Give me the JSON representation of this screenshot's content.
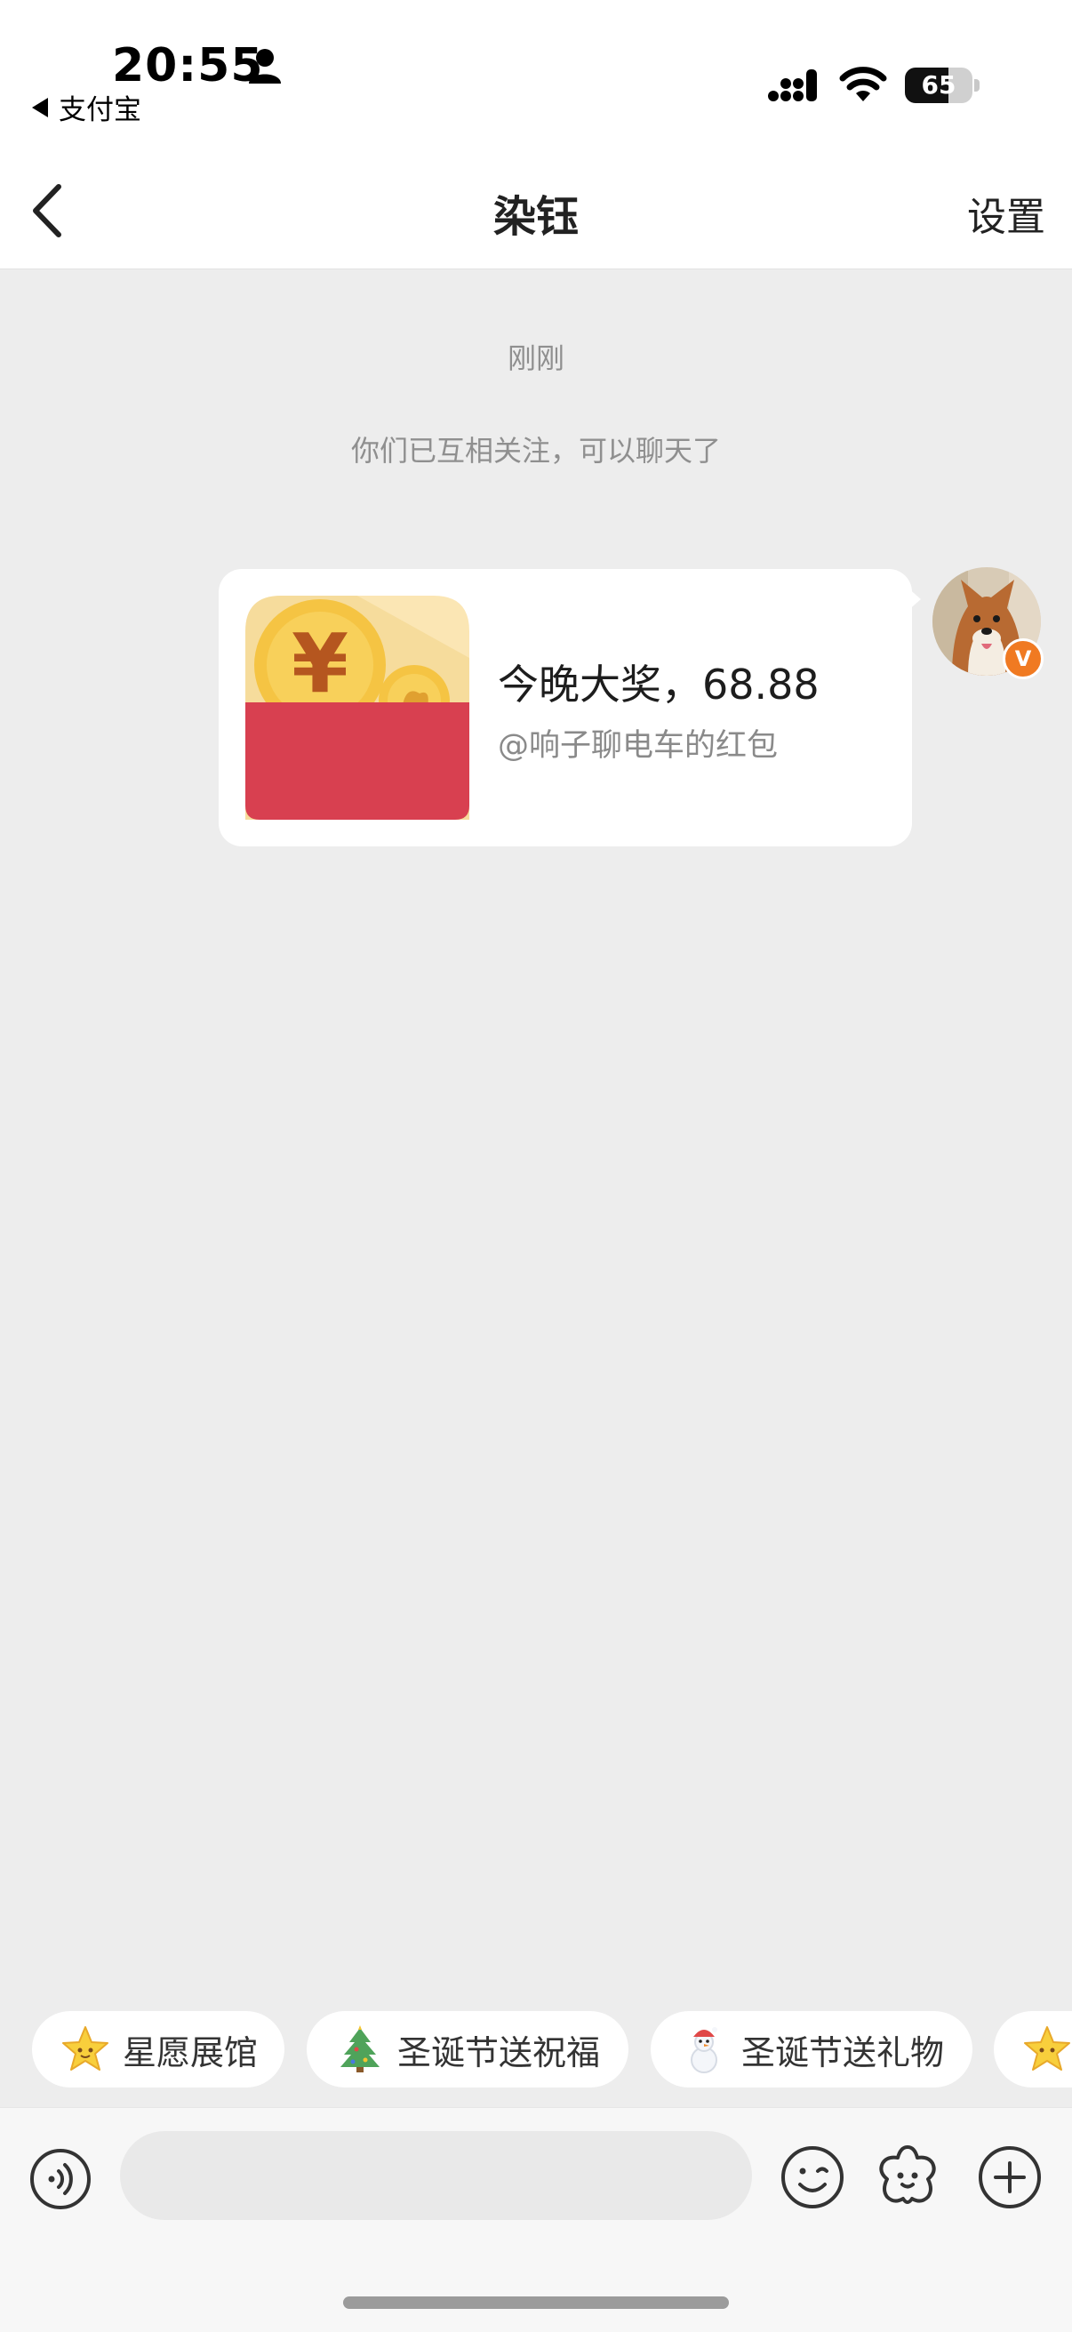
{
  "status_bar": {
    "time": "20:55",
    "back_app": "支付宝",
    "battery": "65",
    "battery_level": 0.65
  },
  "nav": {
    "title": "染钰",
    "settings": "设置"
  },
  "chat": {
    "timestamp": "刚刚",
    "system_message": "你们已互相关注，可以聊天了",
    "message": {
      "title": "今晚大奖，68.88",
      "subtitle": "@响子聊电车的红包"
    }
  },
  "avatar": {
    "badge": "V",
    "icon": "shiba-dog-avatar"
  },
  "chips": [
    {
      "label": "星愿展馆",
      "icon": "star-face-icon"
    },
    {
      "label": "圣诞节送祝福",
      "icon": "christmas-tree-icon"
    },
    {
      "label": "圣诞节送礼物",
      "icon": "snowman-icon"
    },
    {
      "label": "",
      "icon": "star-face-icon"
    }
  ],
  "input": {
    "placeholder": ""
  },
  "colors": {
    "background": "#ededed",
    "bubble": "#ffffff",
    "redpacket_red": "#d84050",
    "coin_gold": "#f5c443",
    "badge_orange": "#f07a22"
  }
}
